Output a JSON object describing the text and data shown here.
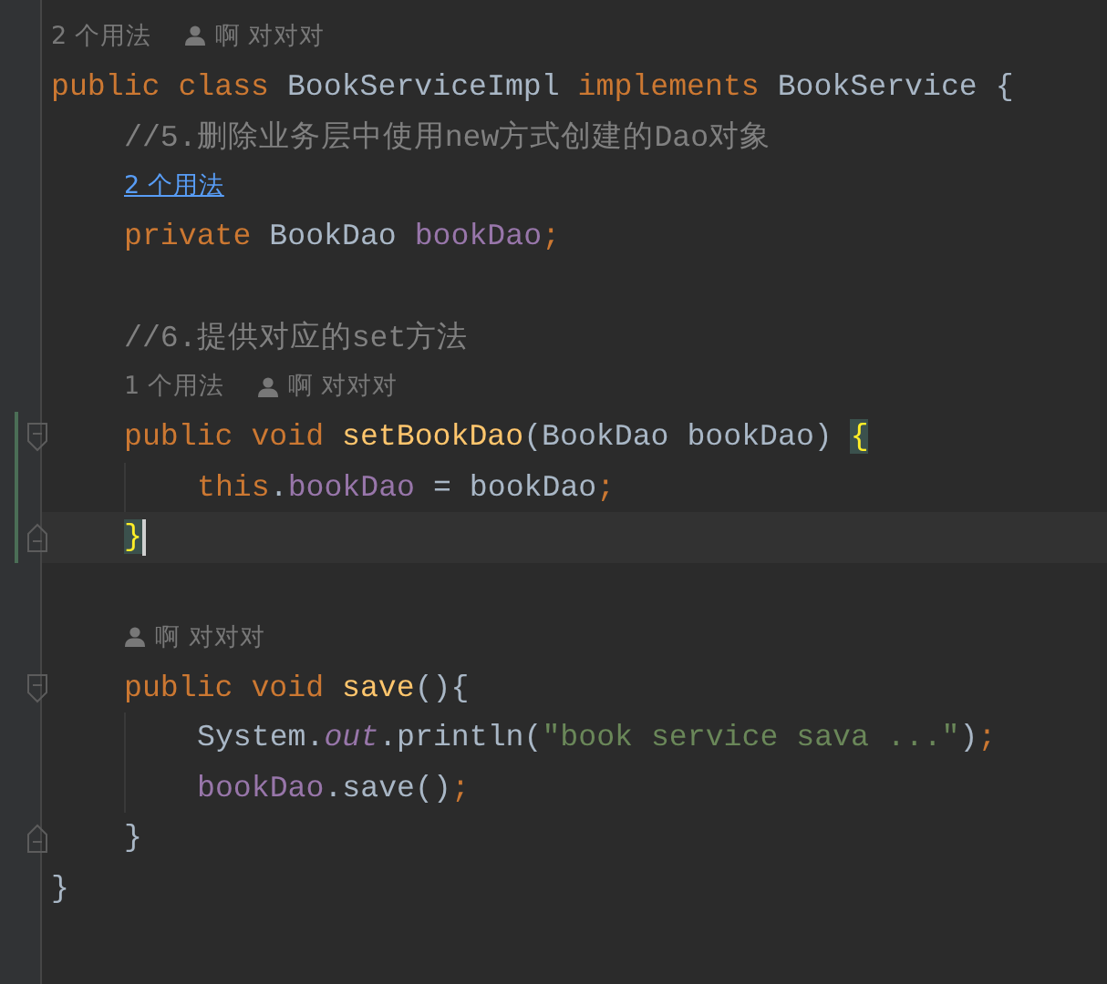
{
  "editor": {
    "lines": [
      {
        "kind": "hint",
        "usages": "2 个用法",
        "hovered": false,
        "author": "啊 对对对"
      },
      {
        "kind": "code",
        "tokens": [
          {
            "kind": "keyword",
            "text": "public class "
          },
          {
            "kind": "plain",
            "text": "BookServiceImpl "
          },
          {
            "kind": "keyword",
            "text": "implements "
          },
          {
            "kind": "plain",
            "text": "BookService {"
          }
        ],
        "children": [
          {
            "kind": "code",
            "tokens": [
              {
                "kind": "comment",
                "text": "//5.删除业务层中使用new方式创建的Dao对象"
              }
            ]
          },
          {
            "kind": "hint",
            "usages": "2 个用法",
            "hovered": true
          },
          {
            "kind": "code",
            "tokens": [
              {
                "kind": "keyword",
                "text": "private "
              },
              {
                "kind": "plain",
                "text": "BookDao "
              },
              {
                "kind": "field",
                "text": "bookDao"
              },
              {
                "kind": "punct",
                "text": ";"
              }
            ]
          },
          {
            "kind": "blank"
          },
          {
            "kind": "code",
            "tokens": [
              {
                "kind": "comment",
                "text": "//6.提供对应的set方法"
              }
            ]
          },
          {
            "kind": "hint",
            "usages": "1 个用法",
            "hovered": false,
            "author": "啊 对对对"
          },
          {
            "kind": "code",
            "fold_start": true,
            "changed": true,
            "tokens": [
              {
                "kind": "keyword",
                "text": "public void "
              },
              {
                "kind": "method",
                "text": "setBookDao"
              },
              {
                "kind": "plain",
                "text": "(BookDao bookDao) "
              },
              {
                "kind": "brace_match",
                "text": "{"
              }
            ],
            "children": [
              {
                "kind": "code",
                "changed": true,
                "tokens": [
                  {
                    "kind": "keyword",
                    "text": "this"
                  },
                  {
                    "kind": "plain",
                    "text": "."
                  },
                  {
                    "kind": "field",
                    "text": "bookDao"
                  },
                  {
                    "kind": "plain",
                    "text": " = bookDao"
                  },
                  {
                    "kind": "punct",
                    "text": ";"
                  }
                ]
              }
            ]
          },
          {
            "kind": "code",
            "fold_end": true,
            "changed": true,
            "current": true,
            "tokens": [
              {
                "kind": "brace_match",
                "text": "}"
              }
            ]
          },
          {
            "kind": "blank"
          },
          {
            "kind": "hint",
            "author": "啊 对对对"
          },
          {
            "kind": "code",
            "fold_start": true,
            "tokens": [
              {
                "kind": "keyword",
                "text": "public void "
              },
              {
                "kind": "method",
                "text": "save"
              },
              {
                "kind": "plain",
                "text": "(){"
              }
            ],
            "children": [
              {
                "kind": "code",
                "tokens": [
                  {
                    "kind": "plain",
                    "text": "System."
                  },
                  {
                    "kind": "static",
                    "text": "out"
                  },
                  {
                    "kind": "plain",
                    "text": ".println("
                  },
                  {
                    "kind": "string",
                    "text": "\"book service sava ...\""
                  },
                  {
                    "kind": "plain",
                    "text": ")"
                  },
                  {
                    "kind": "punct",
                    "text": ";"
                  }
                ]
              },
              {
                "kind": "code",
                "tokens": [
                  {
                    "kind": "field",
                    "text": "bookDao"
                  },
                  {
                    "kind": "plain",
                    "text": ".save()"
                  },
                  {
                    "kind": "punct",
                    "text": ";"
                  }
                ]
              }
            ]
          },
          {
            "kind": "code",
            "fold_end": true,
            "tokens": [
              {
                "kind": "plain",
                "text": "}"
              }
            ]
          }
        ]
      },
      {
        "kind": "code",
        "tokens": [
          {
            "kind": "plain",
            "text": "}"
          }
        ]
      }
    ]
  }
}
